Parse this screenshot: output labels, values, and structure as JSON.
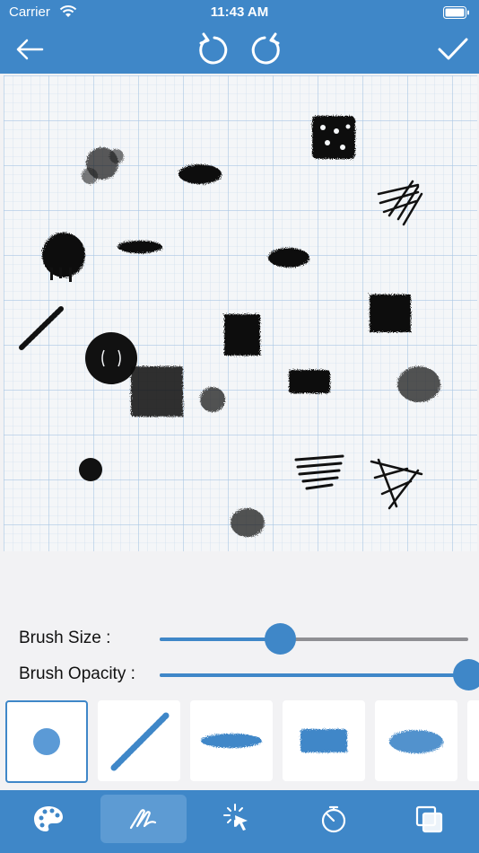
{
  "status_bar": {
    "carrier": "Carrier",
    "time": "11:43 AM"
  },
  "toolbar": {
    "back_icon": "arrow-left-icon",
    "undo_icon": "undo-icon",
    "redo_icon": "redo-icon",
    "done_icon": "checkmark-icon"
  },
  "canvas": {
    "background": "grid-paper"
  },
  "controls": {
    "brush_size_label": "Brush Size :",
    "brush_size_value": 0.39,
    "brush_opacity_label": "Brush Opacity :",
    "brush_opacity_value": 1.0
  },
  "brushes": [
    {
      "name": "round-brush",
      "selected": true
    },
    {
      "name": "beads-brush",
      "selected": false
    },
    {
      "name": "spray-stroke-brush",
      "selected": false
    },
    {
      "name": "rough-stroke-brush",
      "selected": false
    },
    {
      "name": "airbrush-brush",
      "selected": false
    }
  ],
  "tabs": [
    {
      "icon": "palette-icon",
      "active": false
    },
    {
      "icon": "brush-icon",
      "active": true
    },
    {
      "icon": "select-icon",
      "active": false
    },
    {
      "icon": "timer-icon",
      "active": false
    },
    {
      "icon": "layers-icon",
      "active": false
    }
  ],
  "colors": {
    "accent": "#3f87c8",
    "grid": "#b9cfe6",
    "ink": "#111111"
  }
}
